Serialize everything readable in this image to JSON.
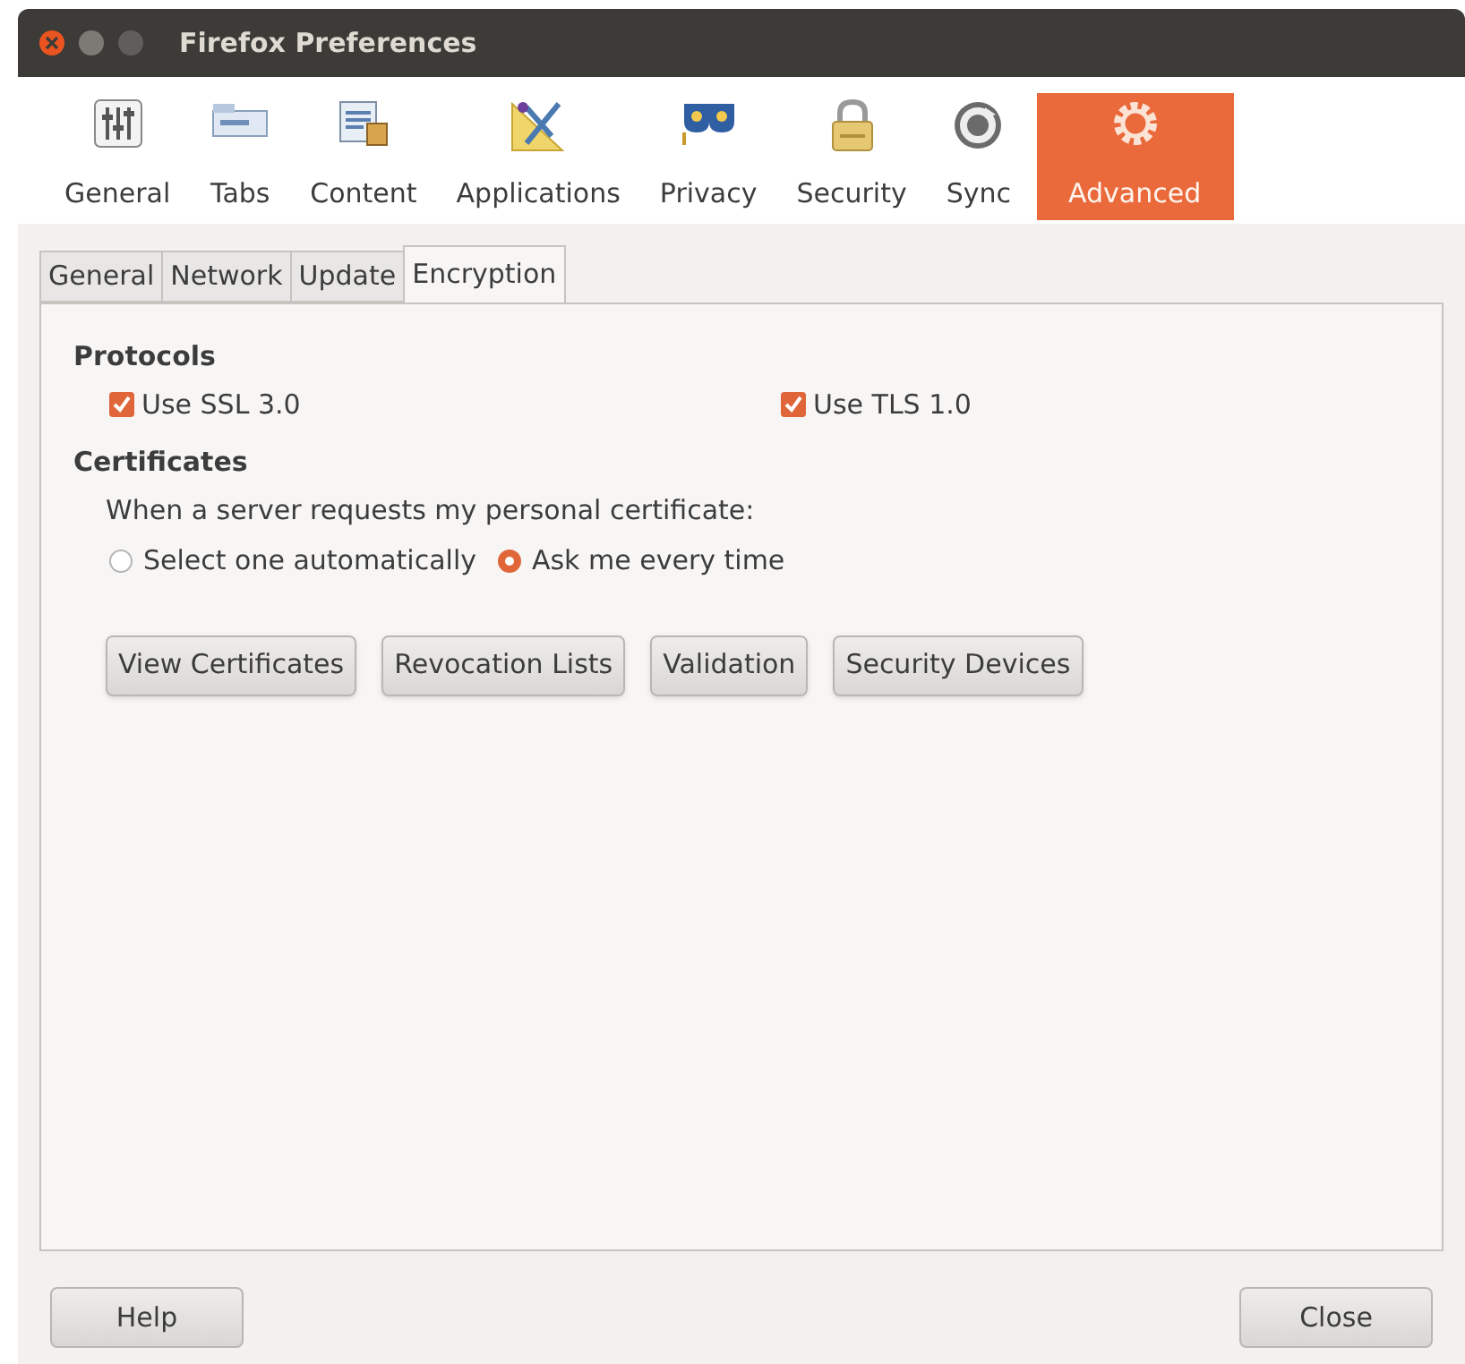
{
  "window": {
    "title": "Firefox Preferences"
  },
  "toolbar": [
    {
      "label": "General",
      "kind": "sliders",
      "selected": false
    },
    {
      "label": "Tabs",
      "kind": "tabs",
      "selected": false
    },
    {
      "label": "Content",
      "kind": "content",
      "selected": false
    },
    {
      "label": "Applications",
      "kind": "applications",
      "selected": false
    },
    {
      "label": "Privacy",
      "kind": "mask",
      "selected": false
    },
    {
      "label": "Security",
      "kind": "lock",
      "selected": false
    },
    {
      "label": "Sync",
      "kind": "sync",
      "selected": false
    },
    {
      "label": "Advanced",
      "kind": "gear",
      "selected": true
    }
  ],
  "subtabs": [
    {
      "label": "General",
      "selected": false
    },
    {
      "label": "Network",
      "selected": false
    },
    {
      "label": "Update",
      "selected": false
    },
    {
      "label": "Encryption",
      "selected": true
    }
  ],
  "protocols": {
    "heading": "Protocols",
    "options": [
      {
        "label": "Use SSL 3.0",
        "checked": true
      },
      {
        "label": "Use TLS 1.0",
        "checked": true
      }
    ]
  },
  "certificates": {
    "heading": "Certificates",
    "prompt": "When a server requests my personal certificate:",
    "choices": [
      {
        "label": "Select one automatically",
        "selected": false
      },
      {
        "label": "Ask me every time",
        "selected": true
      }
    ],
    "buttons": [
      "View Certificates",
      "Revocation Lists",
      "Validation",
      "Security Devices"
    ]
  },
  "footer": {
    "help": "Help",
    "close": "Close"
  }
}
